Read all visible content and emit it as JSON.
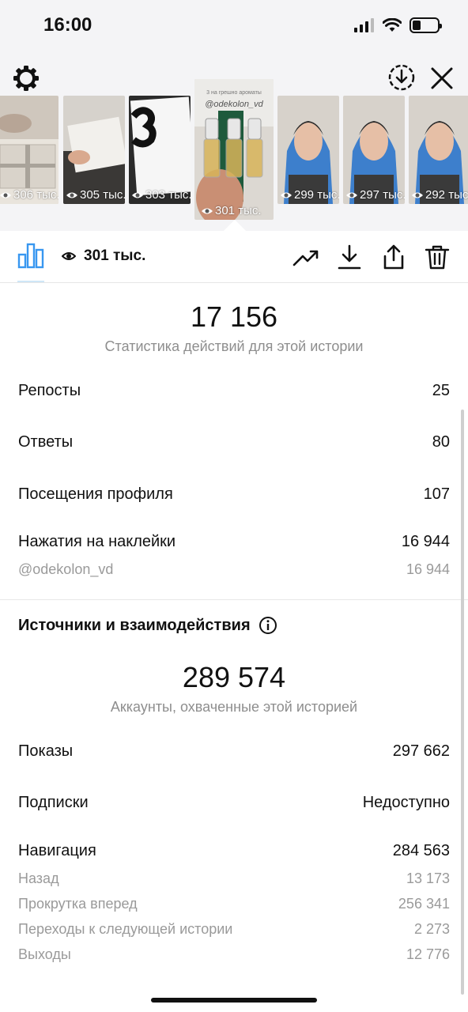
{
  "status_bar": {
    "time": "16:00"
  },
  "thumbnails": [
    {
      "views": "306 тыс.",
      "selected": false
    },
    {
      "views": "305 тыс.",
      "selected": false
    },
    {
      "views": "303 тыс.",
      "selected": false
    },
    {
      "views": "301 тыс.",
      "selected": true
    },
    {
      "views": "299 тыс.",
      "selected": false
    },
    {
      "views": "297 тыс.",
      "selected": false
    },
    {
      "views": "292 тыс.",
      "selected": false
    }
  ],
  "selected_story": {
    "text_line": "3 на грешно ароматы",
    "mention": "@odekolon_vd"
  },
  "toolbar": {
    "views": "301 тыс."
  },
  "actions": {
    "total": "17 156",
    "caption": "Статистика действий для этой истории",
    "rows": [
      {
        "label": "Репосты",
        "value": "25"
      },
      {
        "label": "Ответы",
        "value": "80"
      },
      {
        "label": "Посещения профиля",
        "value": "107"
      },
      {
        "label": "Нажатия на наклейки",
        "value": "16 944"
      }
    ],
    "sub_rows": [
      {
        "label": "@odekolon_vd",
        "value": "16 944"
      }
    ]
  },
  "discovery": {
    "title": "Источники и взаимодействия",
    "total": "289 574",
    "caption": "Аккаунты, охваченные этой историей",
    "rows": [
      {
        "label": "Показы",
        "value": "297 662"
      },
      {
        "label": "Подписки",
        "value": "Недоступно"
      },
      {
        "label": "Навигация",
        "value": "284 563"
      }
    ],
    "navigation": [
      {
        "label": "Назад",
        "value": "13 173"
      },
      {
        "label": "Прокрутка вперед",
        "value": "256 341"
      },
      {
        "label": "Переходы к следующей истории",
        "value": "2 273"
      },
      {
        "label": "Выходы",
        "value": "12 776"
      }
    ]
  },
  "colors": {
    "accent": "#3897f0",
    "muted_text": "#8e8e8e",
    "header_bg": "#f4f4f6"
  }
}
